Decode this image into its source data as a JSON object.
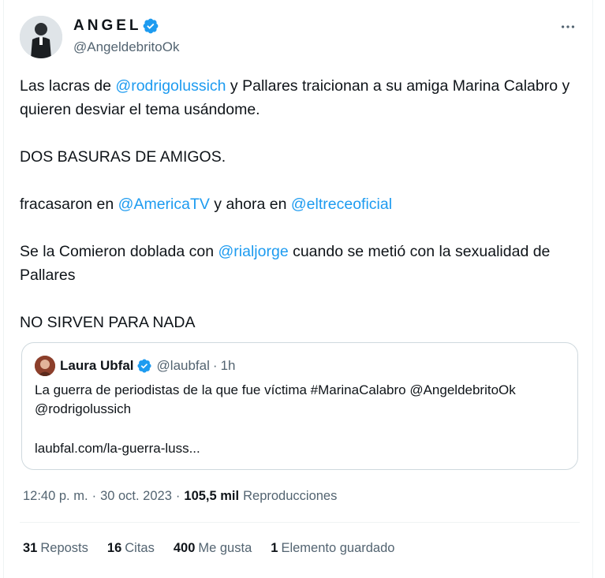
{
  "author": {
    "display_name": "ANGEL",
    "handle": "@AngeldebritoOk",
    "verified_icon": "verified-badge-icon"
  },
  "more_icon": "more-options-icon",
  "tweet": {
    "p1_a": "Las lacras de ",
    "p1_mention": "@rodrigolussich",
    "p1_b": " y Pallares traicionan a su amiga Marina Calabro y quieren desviar el tema usándome.",
    "p2": "DOS BASURAS DE AMIGOS.",
    "p3_a": "fracasaron en ",
    "p3_mention1": "@AmericaTV",
    "p3_b": " y ahora en ",
    "p3_mention2": "@eltreceoficial",
    "p4_a": "Se la Comieron doblada con ",
    "p4_mention": "@rialjorge",
    "p4_b": " cuando se metió con la sexualidad de Pallares",
    "p5": "NO SIRVEN PARA NADA"
  },
  "quote": {
    "name": "Laura Ubfal",
    "handle": "@laubfal",
    "dot": "·",
    "time": "1h",
    "text_line1": "La guerra de periodistas de la que fue víctima #MarinaCalabro @AngeldebritoOk",
    "text_line2": "@rodrigolussich",
    "link": "laubfal.com/la-guerra-luss..."
  },
  "meta": {
    "time": "12:40 p. m.",
    "dot": "·",
    "date": "30 oct. 2023",
    "views_count": "105,5 mil",
    "views_label": "Reproducciones"
  },
  "stats": {
    "reposts_count": "31",
    "reposts_label": "Reposts",
    "quotes_count": "16",
    "quotes_label": "Citas",
    "likes_count": "400",
    "likes_label": "Me gusta",
    "bookmarks_count": "1",
    "bookmarks_label": "Elemento guardado"
  },
  "colors": {
    "link": "#1d9bf0",
    "secondary_text": "#536471",
    "primary_text": "#0f1419",
    "verified": "#1d9bf0"
  }
}
